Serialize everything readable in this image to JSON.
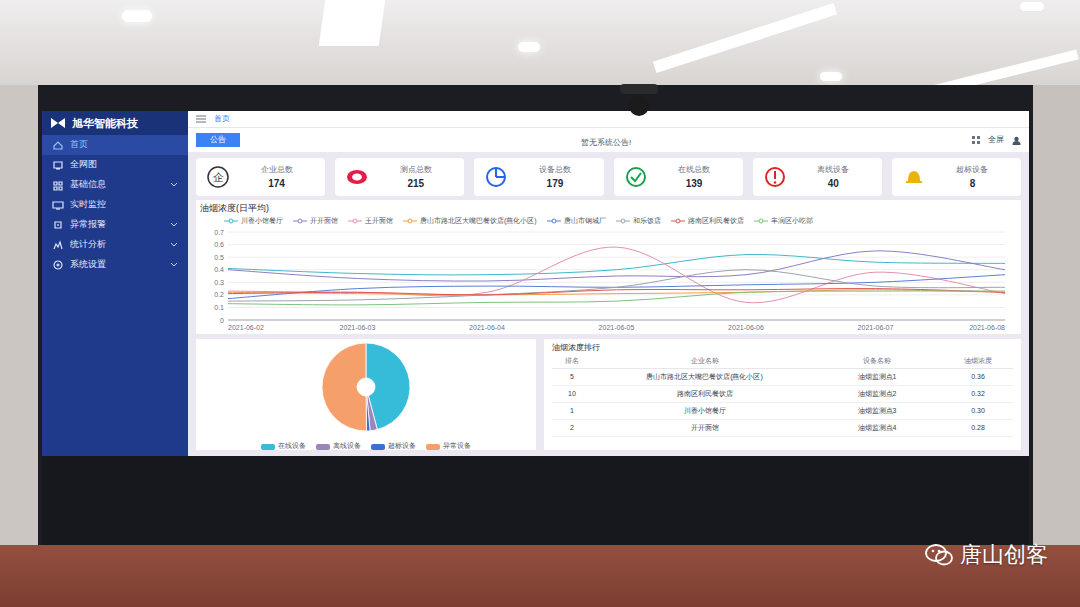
{
  "sidebar": {
    "logo": "旭华智能科技",
    "items": [
      {
        "label": "首页",
        "selected": true,
        "expandable": false
      },
      {
        "label": "全网图",
        "selected": false,
        "expandable": false
      },
      {
        "label": "基础信息",
        "selected": false,
        "expandable": true
      },
      {
        "label": "实时监控",
        "selected": false,
        "expandable": false
      },
      {
        "label": "异常报警",
        "selected": false,
        "expandable": true
      },
      {
        "label": "统计分析",
        "selected": false,
        "expandable": true
      },
      {
        "label": "系统设置",
        "selected": false,
        "expandable": true
      }
    ]
  },
  "topbar": {
    "tab": "首页",
    "notice_button": "公告",
    "notice": "暂无系统公告!",
    "fullscreen": "全屏"
  },
  "stats": [
    {
      "label": "企业总数",
      "value": "174",
      "color": "#333333",
      "kind": "glyph",
      "glyph": "企"
    },
    {
      "label": "测点总数",
      "value": "215",
      "color": "#e11d48",
      "kind": "target"
    },
    {
      "label": "设备总数",
      "value": "179",
      "color": "#2563eb",
      "kind": "pie"
    },
    {
      "label": "在线总数",
      "value": "139",
      "color": "#16a34a",
      "kind": "check"
    },
    {
      "label": "离线设备",
      "value": "40",
      "color": "#dc2626",
      "kind": "alert"
    },
    {
      "label": "超标设备",
      "value": "8",
      "color": "#eab308",
      "kind": "bell"
    }
  ],
  "chart": {
    "title": "油烟浓度(日平均)",
    "y_ticks": [
      "0",
      "0.1",
      "0.2",
      "0.3",
      "0.4",
      "0.5",
      "0.6",
      "0.7"
    ],
    "x_ticks": [
      "2021-06-02",
      "2021-06-03",
      "2021-06-04",
      "2021-06-05",
      "2021-06-06",
      "2021-06-07",
      "2021-06-08"
    ],
    "series": [
      {
        "name": "川香小馆餐厅",
        "color": "#3fb8c9",
        "values": [
          0.41,
          0.37,
          0.36,
          0.4,
          0.52,
          0.46,
          0.45
        ]
      },
      {
        "name": "开开面馆",
        "color": "#8b7fc4",
        "values": [
          0.4,
          0.33,
          0.31,
          0.35,
          0.36,
          0.55,
          0.4
        ]
      },
      {
        "name": "王开面馆",
        "color": "#e58fb0",
        "values": [
          0.23,
          0.22,
          0.22,
          0.58,
          0.14,
          0.38,
          0.21
        ]
      },
      {
        "name": "唐山市路北区大嘴巴餐饮店(燕化小区)",
        "color": "#f0a04b",
        "values": [
          0.22,
          0.21,
          0.2,
          0.21,
          0.22,
          0.24,
          0.22
        ]
      },
      {
        "name": "唐山市钢城厂",
        "color": "#5b7fd6",
        "values": [
          0.17,
          0.25,
          0.27,
          0.26,
          0.28,
          0.3,
          0.36
        ]
      },
      {
        "name": "和乐饭店",
        "color": "#9ca3af",
        "values": [
          0.15,
          0.16,
          0.2,
          0.26,
          0.4,
          0.27,
          0.26
        ]
      },
      {
        "name": "路南区利民餐饮店",
        "color": "#e25555",
        "values": [
          0.21,
          0.22,
          0.2,
          0.24,
          0.24,
          0.25,
          0.22
        ]
      },
      {
        "name": "丰润区小吃部",
        "color": "#7cc47f",
        "values": [
          0.13,
          0.12,
          0.14,
          0.15,
          0.22,
          0.23,
          0.23
        ]
      }
    ]
  },
  "pie": {
    "slices": [
      {
        "name": "在线设备",
        "value": 139,
        "color": "#36bcd8"
      },
      {
        "name": "离线设备",
        "value": 8,
        "color": "#9a86b8"
      },
      {
        "name": "超标设备",
        "value": 4,
        "color": "#3b6fd1"
      },
      {
        "name": "异常设备",
        "value": 152,
        "color": "#f5a06a"
      }
    ]
  },
  "ranking": {
    "title": "油烟浓度排行",
    "columns": [
      "排名",
      "企业名称",
      "设备名称",
      "油烟浓度"
    ],
    "rows": [
      [
        "5",
        "唐山市路北区大嘴巴餐饮店(燕化小区)",
        "油烟监测点1",
        "0.36"
      ],
      [
        "10",
        "路南区利民餐饮店",
        "油烟监测点2",
        "0.32"
      ],
      [
        "1",
        "川香小馆餐厅",
        "油烟监测点3",
        "0.30"
      ],
      [
        "2",
        "开开面馆",
        "油烟监测点4",
        "0.28"
      ]
    ]
  },
  "watermark": {
    "text": "唐山创客"
  }
}
